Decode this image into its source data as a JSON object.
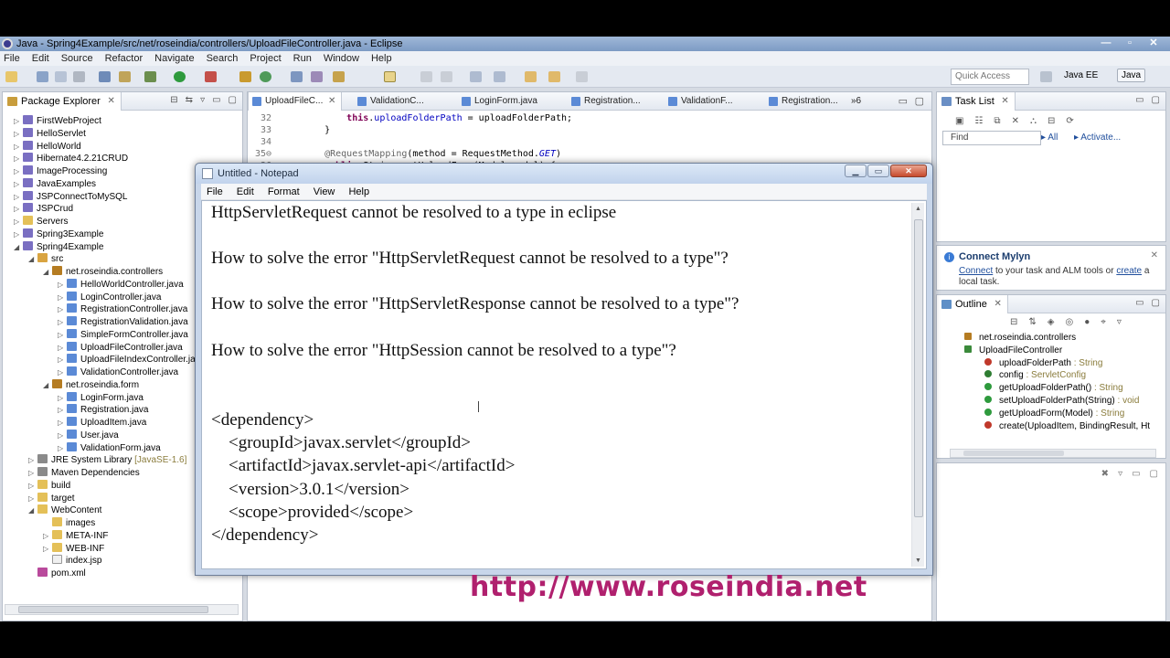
{
  "window": {
    "title": "Java - Spring4Example/src/net/roseindia/controllers/UploadFileController.java - Eclipse",
    "controls": [
      "—",
      "▫",
      "✕"
    ]
  },
  "menu": [
    "File",
    "Edit",
    "Source",
    "Refactor",
    "Navigate",
    "Search",
    "Project",
    "Run",
    "Window",
    "Help"
  ],
  "toolbar": {
    "quick_access_placeholder": "Quick Access",
    "perspective_javaee": "Java EE",
    "perspective_java": "Java"
  },
  "package_explorer": {
    "tab_label": "Package Explorer",
    "tree": [
      {
        "label": "FirstWebProject",
        "icon": "project-icon",
        "depth": 0,
        "twisty": "▷"
      },
      {
        "label": "HelloServlet",
        "icon": "project-icon",
        "depth": 0,
        "twisty": "▷"
      },
      {
        "label": "HelloWorld",
        "icon": "project-icon",
        "depth": 0,
        "twisty": "▷"
      },
      {
        "label": "Hibernate4.2.21CRUD",
        "icon": "project-icon",
        "depth": 0,
        "twisty": "▷"
      },
      {
        "label": "ImageProcessing",
        "icon": "project-icon",
        "depth": 0,
        "twisty": "▷"
      },
      {
        "label": "JavaExamples",
        "icon": "project-icon",
        "depth": 0,
        "twisty": "▷"
      },
      {
        "label": "JSPConnectToMySQL",
        "icon": "project-icon",
        "depth": 0,
        "twisty": "▷"
      },
      {
        "label": "JSPCrud",
        "icon": "project-icon",
        "depth": 0,
        "twisty": "▷"
      },
      {
        "label": "Servers",
        "icon": "folder-icon",
        "depth": 0,
        "twisty": "▷"
      },
      {
        "label": "Spring3Example",
        "icon": "project-icon",
        "depth": 0,
        "twisty": "▷"
      },
      {
        "label": "Spring4Example",
        "icon": "project-icon",
        "depth": 0,
        "twisty": "◢"
      },
      {
        "label": "src",
        "icon": "source-folder-icon",
        "depth": 1,
        "twisty": "◢"
      },
      {
        "label": "net.roseindia.controllers",
        "icon": "package-icon",
        "depth": 2,
        "twisty": "◢"
      },
      {
        "label": "HelloWorldController.java",
        "icon": "java-file-icon",
        "depth": 3,
        "twisty": "▷"
      },
      {
        "label": "LoginController.java",
        "icon": "java-file-icon",
        "depth": 3,
        "twisty": "▷"
      },
      {
        "label": "RegistrationController.java",
        "icon": "java-file-icon",
        "depth": 3,
        "twisty": "▷"
      },
      {
        "label": "RegistrationValidation.java",
        "icon": "java-file-icon",
        "depth": 3,
        "twisty": "▷"
      },
      {
        "label": "SimpleFormController.java",
        "icon": "java-file-icon",
        "depth": 3,
        "twisty": "▷"
      },
      {
        "label": "UploadFileController.java",
        "icon": "java-file-icon",
        "depth": 3,
        "twisty": "▷"
      },
      {
        "label": "UploadFileIndexController.java",
        "icon": "java-file-icon",
        "depth": 3,
        "twisty": "▷"
      },
      {
        "label": "ValidationController.java",
        "icon": "java-file-icon",
        "depth": 3,
        "twisty": "▷"
      },
      {
        "label": "net.roseindia.form",
        "icon": "package-icon",
        "depth": 2,
        "twisty": "◢"
      },
      {
        "label": "LoginForm.java",
        "icon": "java-file-icon",
        "depth": 3,
        "twisty": "▷"
      },
      {
        "label": "Registration.java",
        "icon": "java-file-icon",
        "depth": 3,
        "twisty": "▷"
      },
      {
        "label": "UploadItem.java",
        "icon": "java-file-icon",
        "depth": 3,
        "twisty": "▷"
      },
      {
        "label": "User.java",
        "icon": "java-file-icon",
        "depth": 3,
        "twisty": "▷"
      },
      {
        "label": "ValidationForm.java",
        "icon": "java-file-icon",
        "depth": 3,
        "twisty": "▷"
      },
      {
        "label": "JRE System Library",
        "suffix": " [JavaSE-1.6]",
        "icon": "library-icon",
        "depth": 1,
        "twisty": "▷"
      },
      {
        "label": "Maven Dependencies",
        "icon": "library-icon",
        "depth": 1,
        "twisty": "▷"
      },
      {
        "label": "build",
        "icon": "folder-icon",
        "depth": 1,
        "twisty": "▷"
      },
      {
        "label": "target",
        "icon": "folder-icon",
        "depth": 1,
        "twisty": "▷"
      },
      {
        "label": "WebContent",
        "icon": "folder-icon",
        "depth": 1,
        "twisty": "◢"
      },
      {
        "label": "images",
        "icon": "folder-icon",
        "depth": 2,
        "twisty": ""
      },
      {
        "label": "META-INF",
        "icon": "folder-icon",
        "depth": 2,
        "twisty": "▷"
      },
      {
        "label": "WEB-INF",
        "icon": "folder-icon",
        "depth": 2,
        "twisty": "▷"
      },
      {
        "label": "index.jsp",
        "icon": "file-icon",
        "depth": 2,
        "twisty": ""
      },
      {
        "label": "pom.xml",
        "icon": "xml-file-icon",
        "depth": 1,
        "twisty": ""
      }
    ]
  },
  "editor": {
    "tabs": [
      "UploadFileC...",
      "ValidationC...",
      "LoginForm.java",
      "Registration...",
      "ValidationF...",
      "Registration..."
    ],
    "overflow": "»6",
    "lines": [
      {
        "n": "32",
        "html": "        <span class=\"kw\">this</span>.<span class=\"fld\">uploadFolderPath</span> = uploadFolderPath;"
      },
      {
        "n": "33",
        "html": "    }"
      },
      {
        "n": "34",
        "html": ""
      },
      {
        "n": "35⊖",
        "html": "    <span class=\"ann\">@RequestMapping</span>(method = RequestMethod.<span class=\"it\">GET</span>)"
      },
      {
        "n": "36",
        "html": "    <span class=\"kw\">public</span> String getUploadForm(Model model) {"
      }
    ]
  },
  "task_list": {
    "tab_label": "Task List",
    "find_placeholder": "Find",
    "all_label": "All",
    "activate_label": "Activate..."
  },
  "mylyn": {
    "title": "Connect Mylyn",
    "text_link1": "Connect",
    "text_mid": " to your task and ALM tools or ",
    "text_link2": "create",
    "text_end": " a local task."
  },
  "outline": {
    "tab_label": "Outline",
    "rows": [
      {
        "label": "net.roseindia.controllers",
        "type": "",
        "kind": "package",
        "indent": 0
      },
      {
        "label": "UploadFileController",
        "type": "",
        "kind": "class",
        "indent": 0
      },
      {
        "label": "uploadFolderPath",
        "type": " : String",
        "kind": "private-field",
        "indent": 1
      },
      {
        "label": "config",
        "type": " : ServletConfig",
        "kind": "field",
        "indent": 1
      },
      {
        "label": "getUploadFolderPath()",
        "type": " : String",
        "kind": "public-method",
        "indent": 1
      },
      {
        "label": "setUploadFolderPath(String)",
        "type": " : void",
        "kind": "public-method",
        "indent": 1
      },
      {
        "label": "getUploadForm(Model)",
        "type": " : String",
        "kind": "public-method",
        "indent": 1
      },
      {
        "label": "create(UploadItem, BindingResult, Ht",
        "type": "",
        "kind": "method",
        "indent": 1
      }
    ]
  },
  "notepad": {
    "title": "Untitled - Notepad",
    "menu": [
      "File",
      "Edit",
      "Format",
      "View",
      "Help"
    ],
    "lines": [
      {
        "text": "HttpServletRequest cannot be resolved to a type in eclipse",
        "row": 0
      },
      {
        "text": "How to solve the error \"HttpServletRequest cannot be resolved to a type\"?",
        "row": 1
      },
      {
        "text": "How to solve the error \"HttpServletResponse cannot be resolved to a type\"?",
        "row": 2
      },
      {
        "text": "How to solve the error \"HttpSession cannot be resolved to a type\"?",
        "row": 3
      },
      {
        "text": "<dependency>",
        "row": 4
      },
      {
        "text": "    <groupId>javax.servlet</groupId>",
        "row": 5
      },
      {
        "text": "    <artifactId>javax.servlet-api</artifactId>",
        "row": 6
      },
      {
        "text": "    <version>3.0.1</version>",
        "row": 7
      },
      {
        "text": "    <scope>provided</scope>",
        "row": 8
      },
      {
        "text": "</dependency>",
        "row": 9
      }
    ]
  },
  "watermark": "http://www.roseindia.net",
  "colors": {
    "watermark": "#b0206e",
    "java_keyword": "#7f0055",
    "link": "#1f4e9c"
  }
}
